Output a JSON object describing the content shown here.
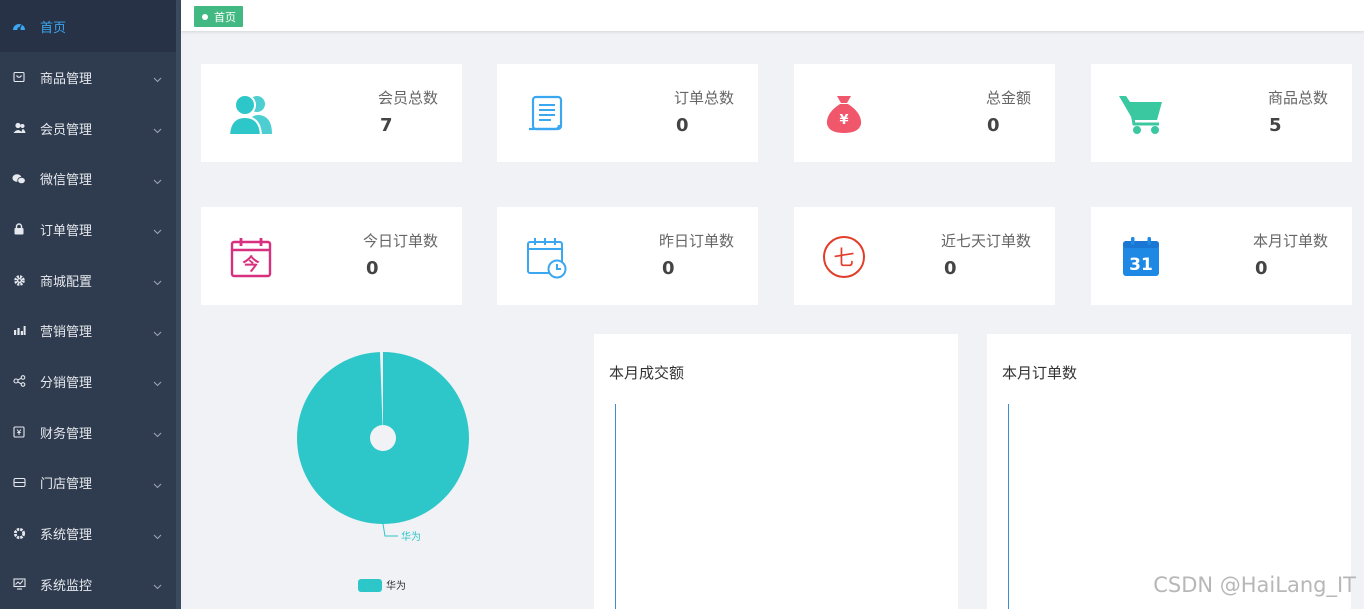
{
  "sidebar": {
    "items": [
      {
        "label": "首页",
        "icon": "dashboard-icon",
        "active": true
      },
      {
        "label": "商品管理",
        "icon": "product-icon"
      },
      {
        "label": "会员管理",
        "icon": "user-icon"
      },
      {
        "label": "微信管理",
        "icon": "wechat-icon"
      },
      {
        "label": "订单管理",
        "icon": "lock-icon"
      },
      {
        "label": "商城配置",
        "icon": "gear-icon"
      },
      {
        "label": "营销管理",
        "icon": "bar-chart-icon"
      },
      {
        "label": "分销管理",
        "icon": "share-icon"
      },
      {
        "label": "财务管理",
        "icon": "finance-icon"
      },
      {
        "label": "门店管理",
        "icon": "store-icon"
      },
      {
        "label": "系统管理",
        "icon": "cog-icon"
      },
      {
        "label": "系统监控",
        "icon": "monitor-icon"
      }
    ]
  },
  "tab": {
    "label": "首页"
  },
  "stats": [
    {
      "label": "会员总数",
      "value": "7",
      "icon": "members-icon",
      "color": "#2ec7c9"
    },
    {
      "label": "订单总数",
      "value": "0",
      "icon": "scroll-icon",
      "color": "#3ba7f1"
    },
    {
      "label": "总金额",
      "value": "0",
      "icon": "money-bag-icon",
      "color": "#f0576a"
    },
    {
      "label": "商品总数",
      "value": "5",
      "icon": "cart-icon",
      "color": "#39c8a0"
    },
    {
      "label": "今日订单数",
      "value": "0",
      "icon": "calendar-today-icon",
      "color": "#d6307e",
      "glyph": "今"
    },
    {
      "label": "昨日订单数",
      "value": "0",
      "icon": "calendar-clock-icon",
      "color": "#3ba7f1"
    },
    {
      "label": "近七天订单数",
      "value": "0",
      "icon": "seven-circle-icon",
      "color": "#e23c2a",
      "glyph": "七"
    },
    {
      "label": "本月订单数",
      "value": "0",
      "icon": "calendar-31-icon",
      "color": "#1e88e5",
      "glyph": "31"
    }
  ],
  "pie": {
    "slice_label": "华为",
    "legend_label": "华为",
    "color": "#2ec7c9"
  },
  "chart_data": {
    "type": "pie",
    "categories": [
      "华为"
    ],
    "values": [
      1
    ]
  },
  "panels": {
    "revenue_title": "本月成交额",
    "orders_title": "本月订单数"
  },
  "watermark": "CSDN @HaiLang_IT"
}
